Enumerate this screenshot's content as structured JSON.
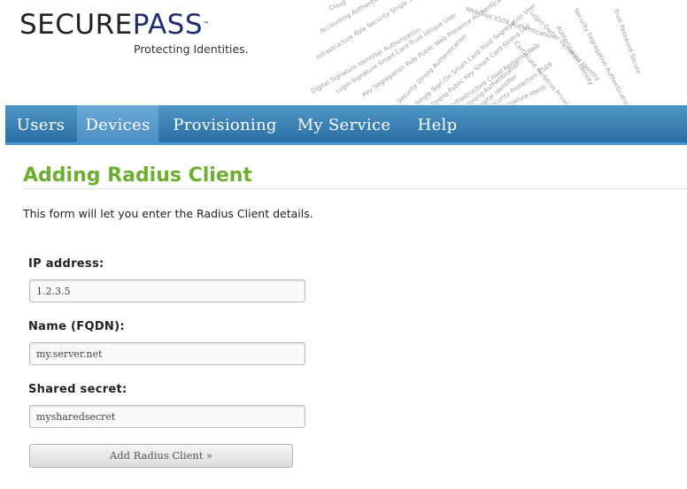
{
  "header": {
    "logo_secure": "SECURE",
    "logo_pass": "PASS",
    "logo_tm": "™",
    "tagline": "Protecting Identities.",
    "word_cloud": [
      "Cloud",
      "Accounting Authentic",
      "Infrastructure Role Security Single Si",
      "Digital Signature Identifier Authorization",
      "Login Signature Smart Card Trust Unique User",
      "Key Segregation Role Public Web Presence Authentication",
      "Security Strong Authentication",
      "Single Sign-On Smart Card Trust Segregation User",
      "Strong Public Key Smart Card Strong Log",
      "Infrastructure Cloud Kerberos Web",
      "Strong Authentication",
      "Digital Identifier",
      "Security Protection X509",
      "Signature Identi",
      "Web Tool X509 Authentication",
      "Login Owner Password Identity",
      "Certificate Kerberos Privacy Cryptography",
      "Security Segregation Authentication",
      "Authorization Identity",
      "Trust Password Secure"
    ]
  },
  "nav": {
    "items": [
      {
        "label": "Users"
      },
      {
        "label": "Devices"
      },
      {
        "label": "Provisioning"
      },
      {
        "label": "My Service"
      },
      {
        "label": "Help"
      }
    ],
    "active": "Devices"
  },
  "main": {
    "title": "Adding Radius Client",
    "intro": "This form will let you enter the Radius Client details.",
    "fields": [
      {
        "label": "IP address:",
        "value": "1.2.3.5"
      },
      {
        "label": "Name (FQDN):",
        "value": "my.server.net"
      },
      {
        "label": "Shared secret:",
        "value": "mysharedsecret"
      }
    ],
    "submit_label": "Add Radius Client »"
  },
  "colors": {
    "nav_blue": "#2b6fa3",
    "title_green": "#6cae2e",
    "logo_navy": "#1d2f6f"
  }
}
